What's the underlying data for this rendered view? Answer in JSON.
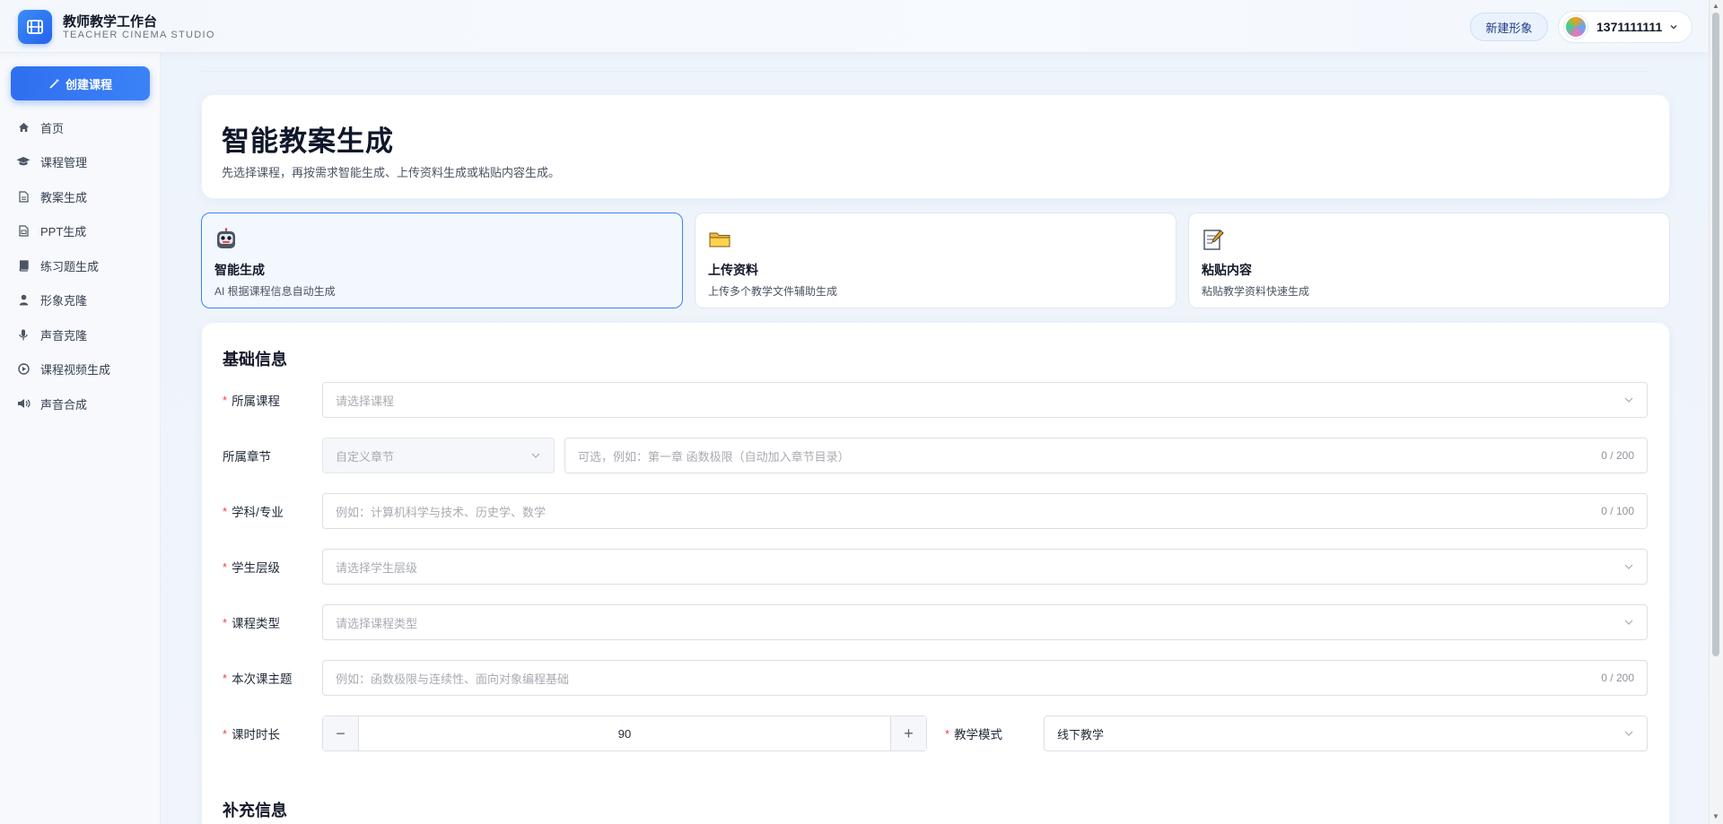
{
  "header": {
    "brand_title": "教师教学工作台",
    "brand_subtitle": "TEACHER CINEMA STUDIO",
    "new_avatar_label": "新建形象",
    "user_name": "1371111111"
  },
  "sidebar": {
    "create_label": "创建课程",
    "items": [
      {
        "label": "首页",
        "icon": "home-icon"
      },
      {
        "label": "课程管理",
        "icon": "graduation-cap-icon"
      },
      {
        "label": "教案生成",
        "icon": "document-icon"
      },
      {
        "label": "PPT生成",
        "icon": "slides-icon"
      },
      {
        "label": "练习题生成",
        "icon": "book-icon"
      },
      {
        "label": "形象克隆",
        "icon": "user-icon"
      },
      {
        "label": "声音克隆",
        "icon": "microphone-icon"
      },
      {
        "label": "课程视频生成",
        "icon": "play-circle-icon"
      },
      {
        "label": "声音合成",
        "icon": "speaker-icon"
      }
    ]
  },
  "page": {
    "title": "智能教案生成",
    "subtitle": "先选择课程，再按需求智能生成、上传资料生成或粘贴内容生成。"
  },
  "modes": [
    {
      "title": "智能生成",
      "desc": "AI 根据课程信息自动生成",
      "icon": "robot-icon",
      "active": true
    },
    {
      "title": "上传资料",
      "desc": "上传多个教学文件辅助生成",
      "icon": "folder-icon",
      "active": false
    },
    {
      "title": "粘贴内容",
      "desc": "粘贴教学资料快速生成",
      "icon": "memo-icon",
      "active": false
    }
  ],
  "form": {
    "section_title": "基础信息",
    "course": {
      "label": "所属课程",
      "placeholder": "请选择课程"
    },
    "chapter": {
      "label": "所属章节",
      "select_placeholder": "自定义章节",
      "input_placeholder": "可选，例如：第一章 函数极限（自动加入章节目录）",
      "counter": "0 / 200"
    },
    "subject": {
      "label": "学科/专业",
      "placeholder": "例如：计算机科学与技术、历史学、数学",
      "counter": "0 / 100"
    },
    "level": {
      "label": "学生层级",
      "placeholder": "请选择学生层级"
    },
    "course_type": {
      "label": "课程类型",
      "placeholder": "请选择课程类型"
    },
    "topic": {
      "label": "本次课主题",
      "placeholder": "例如：函数极限与连续性、面向对象编程基础",
      "counter": "0 / 200"
    },
    "duration": {
      "label": "课时时长",
      "value": "90",
      "minus": "−",
      "plus": "+"
    },
    "mode": {
      "label": "教学模式",
      "value": "线下教学"
    }
  },
  "extra": {
    "section_title": "补充信息"
  },
  "colors": {
    "accent": "#2f6ff0",
    "required": "#ef4444",
    "active_border": "#3b82f6"
  }
}
